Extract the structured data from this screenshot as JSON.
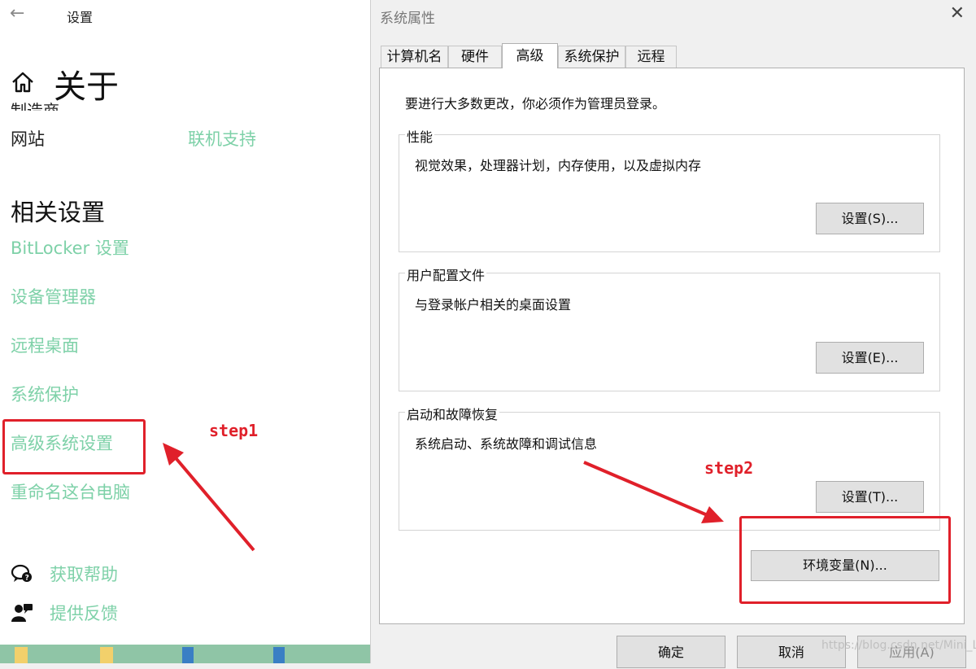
{
  "settings": {
    "title": "设置",
    "back_glyph": "←",
    "page_title": "关于",
    "cut_text": "制造商",
    "website_label": "网站",
    "website_link": "联机支持",
    "related_title": "相关设置",
    "related_links": [
      "BitLocker 设置",
      "设备管理器",
      "远程桌面",
      "系统保护",
      "高级系统设置",
      "重命名这台电脑"
    ],
    "help": "获取帮助",
    "feedback": "提供反馈"
  },
  "dialog": {
    "title": "系统属性",
    "close_glyph": "✕",
    "tabs": [
      "计算机名",
      "硬件",
      "高级",
      "系统保护",
      "远程"
    ],
    "active_tab": "高级",
    "admin_note": "要进行大多数更改，你必须作为管理员登录。",
    "groups": [
      {
        "title": "性能",
        "desc": "视觉效果，处理器计划，内存使用，以及虚拟内存",
        "button": "设置(S)..."
      },
      {
        "title": "用户配置文件",
        "desc": "与登录帐户相关的桌面设置",
        "button": "设置(E)..."
      },
      {
        "title": "启动和故障恢复",
        "desc": "系统启动、系统故障和调试信息",
        "button": "设置(T)..."
      }
    ],
    "env_button": "环境变量(N)...",
    "ok": "确定",
    "cancel": "取消",
    "apply": "应用(A)"
  },
  "annotations": {
    "step1": "step1",
    "step2": "step2",
    "color": "#e0202a"
  },
  "watermark": "https://blog.csdn.net/Mini_Luo",
  "colors": {
    "link": "#7ed1a8",
    "annotation": "#e0202a"
  }
}
